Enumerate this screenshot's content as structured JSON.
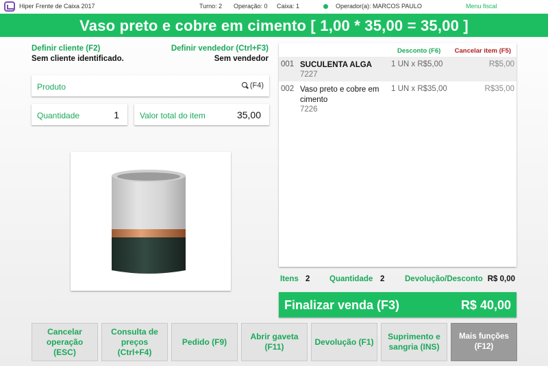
{
  "topbar": {
    "app_title": "Hiper Frente de Caixa 2017",
    "turno": "Turno: 2",
    "operacao": "Operação: 0",
    "caixa": "Caixa: 1",
    "operador": "Operador(a): MARCOS PAULO",
    "menu_fiscal": "Menu fiscal"
  },
  "header": {
    "title": "Vaso preto e cobre em cimento [ 1,00 * 35,00 = 35,00 ]"
  },
  "left": {
    "definir_cliente": "Definir cliente (F2)",
    "sem_cliente": "Sem cliente identificado.",
    "definir_vendedor": "Definir vendedor (Ctrl+F3)",
    "sem_vendedor": "Sem vendedor",
    "produto_label": "Produto",
    "produto_shortcut": "(F4)",
    "quantidade_label": "Quantidade",
    "quantidade_value": "1",
    "valor_total_label": "Valor total do item",
    "valor_total_value": "35,00"
  },
  "items": {
    "desconto": "Desconto (F6)",
    "cancelar_item": "Cancelar item (F5)",
    "rows": [
      {
        "num": "001",
        "name": "SUCULENTA ALGA",
        "code": "7227",
        "qty": "1 UN x R$5,00",
        "price": "R$5,00"
      },
      {
        "num": "002",
        "name": "Vaso preto e cobre em cimento",
        "code": "7226",
        "qty": "1 UN x R$35,00",
        "price": "R$35,00"
      }
    ]
  },
  "summary": {
    "itens_label": "Itens",
    "itens_value": "2",
    "quantidade_label": "Quantidade",
    "quantidade_value": "2",
    "devolucao_label": "Devolução/Desconto",
    "devolucao_value": "R$ 0,00"
  },
  "finalizar": {
    "label": "Finalizar venda (F3)",
    "total": "R$ 40,00"
  },
  "buttons": [
    {
      "label": "Cancelar operação (ESC)"
    },
    {
      "label": "Consulta de preços (Ctrl+F4)"
    },
    {
      "label": "Pedido (F9)"
    },
    {
      "label": "Abrir gaveta (F11)"
    },
    {
      "label": "Devolução (F1)"
    },
    {
      "label": "Suprimento e sangria (INS)"
    },
    {
      "label": "Mais funções (F12)"
    }
  ],
  "colors": {
    "accent_green": "#1dbe62",
    "cancel_red": "#b01e1e",
    "logo_purple": "#7a4fb0"
  }
}
